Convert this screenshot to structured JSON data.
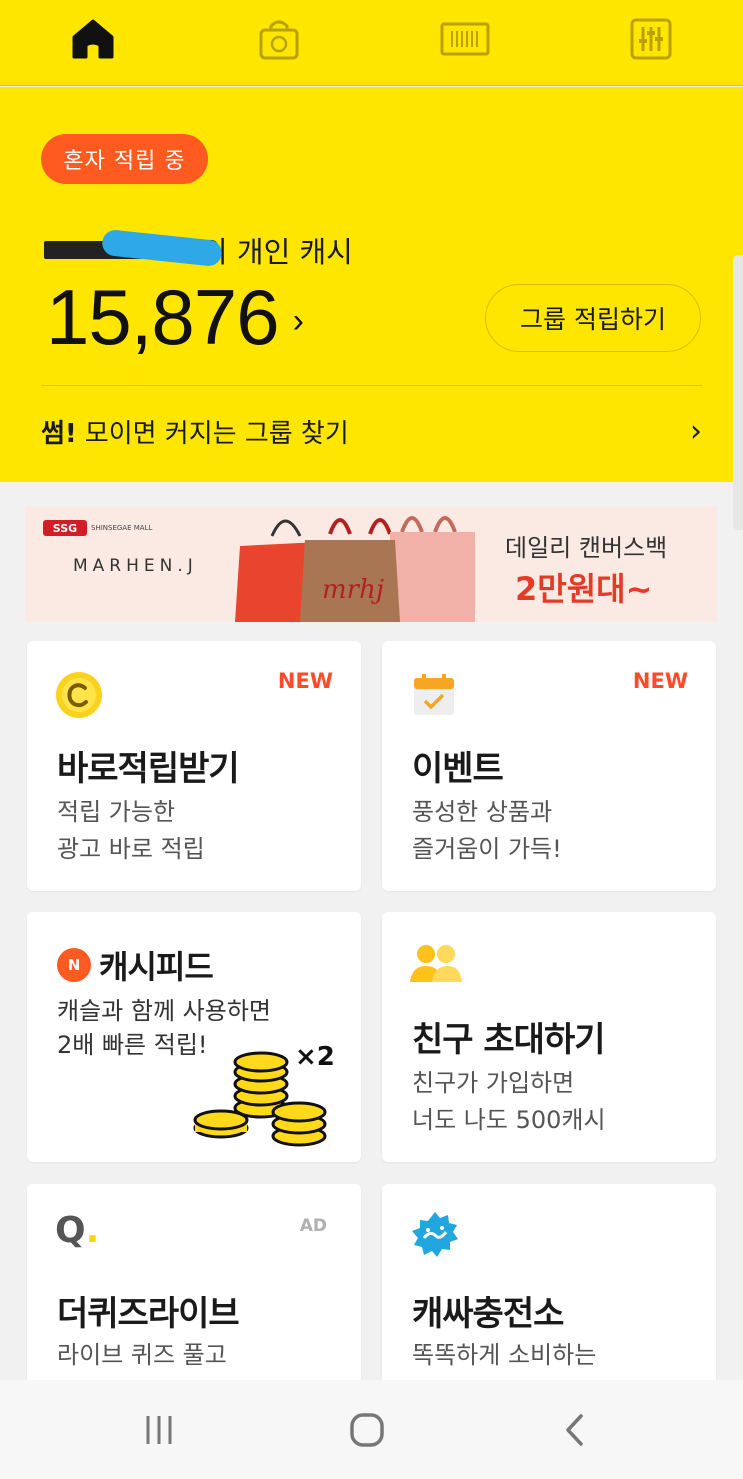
{
  "tabs": [
    {
      "icon": "home-icon",
      "active": true
    },
    {
      "icon": "shopping-bag-icon",
      "active": false
    },
    {
      "icon": "barcode-icon",
      "active": false
    },
    {
      "icon": "settings-sliders-icon",
      "active": false
    }
  ],
  "header": {
    "status_pill": "혼자 적립 중",
    "owner_suffix": "의 개인 캐시",
    "cash_amount": "15,876",
    "cash_chevron": "›",
    "group_button": "그룹 적립하기",
    "find_brand": "썸!",
    "find_text": "모이면 커지는 그룹 찾기",
    "find_arrow": "›"
  },
  "banner": {
    "partner_mark": "SSG",
    "partner_sub": "SHINSEGAE MALL",
    "brand": "MARHEN.J",
    "bag_print": "mrhj",
    "copy_line1": "데일리 캔버스백",
    "copy_line2": "2만원대~"
  },
  "cards": {
    "instant": {
      "badge": "NEW",
      "title": "바로적립받기",
      "desc1": "적립 가능한",
      "desc2": "광고 바로 적립"
    },
    "event": {
      "badge": "NEW",
      "title": "이벤트",
      "desc1": "풍성한 상품과",
      "desc2": "즐거움이 가득!"
    },
    "cashfeed": {
      "title": "캐시피드",
      "icon_letter": "N",
      "desc1": "캐슬과 함께 사용하면",
      "desc2": "2배 빠른 적립!",
      "multiplier": "×2"
    },
    "invite": {
      "title": "친구 초대하기",
      "desc1": "친구가 가입하면",
      "desc2": "너도 나도 500캐시"
    },
    "quiz": {
      "badge": "AD",
      "title": "더퀴즈라이브",
      "desc1": "라이브 퀴즈 풀고",
      "icon_letter": "Q"
    },
    "charge": {
      "title": "캐싸충전소",
      "desc1": "똑똑하게 소비하는"
    }
  },
  "colors": {
    "brand_yellow": "#ffe600",
    "accent_orange": "#ff5a1f",
    "new_badge": "#ff4a2a",
    "sale_red": "#e53a26"
  }
}
